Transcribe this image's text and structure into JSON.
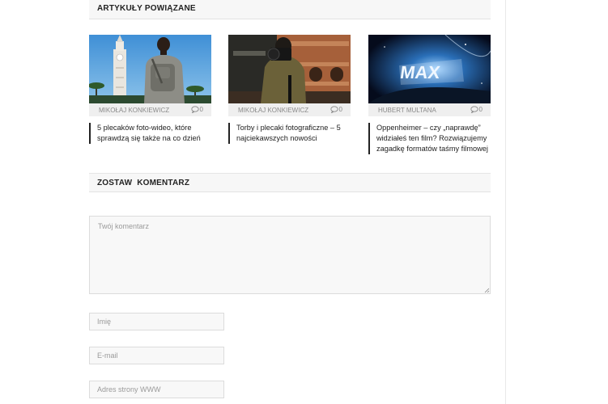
{
  "related": {
    "heading": "ARTYKUŁY POWIĄZANE",
    "cards": [
      {
        "author": "MIKOŁAJ KONKIEWICZ",
        "comment_count": "0",
        "title": "5 plecaków foto-wideo, które sprawdzą się także na co dzień",
        "image_icon": "photo-man-with-backpack"
      },
      {
        "author": "MIKOŁAJ KONKIEWICZ",
        "comment_count": "0",
        "title": "Torby i plecaki fotograficzne – 5 najciekawszych nowości",
        "image_icon": "photo-photographer-with-camera"
      },
      {
        "author": "HUBERT MULTANA",
        "comment_count": "0",
        "title": "Oppenheimer – czy „naprawdę” widziałeś ten film? Rozwiązujemy zagadkę formatów taśmy filmowej",
        "image_icon": "photo-imax-logo-space"
      }
    ]
  },
  "comment_form": {
    "heading": "ZOSTAW  KOMENTARZ",
    "comment_placeholder": "Twój komentarz",
    "name_placeholder": "Imię",
    "email_placeholder": "E-mail",
    "website_placeholder": "Adres strony WWW"
  },
  "colors": {
    "header_bg": "#f7f7f7",
    "meta_bg": "#efefef",
    "title_accent": "#222222"
  }
}
